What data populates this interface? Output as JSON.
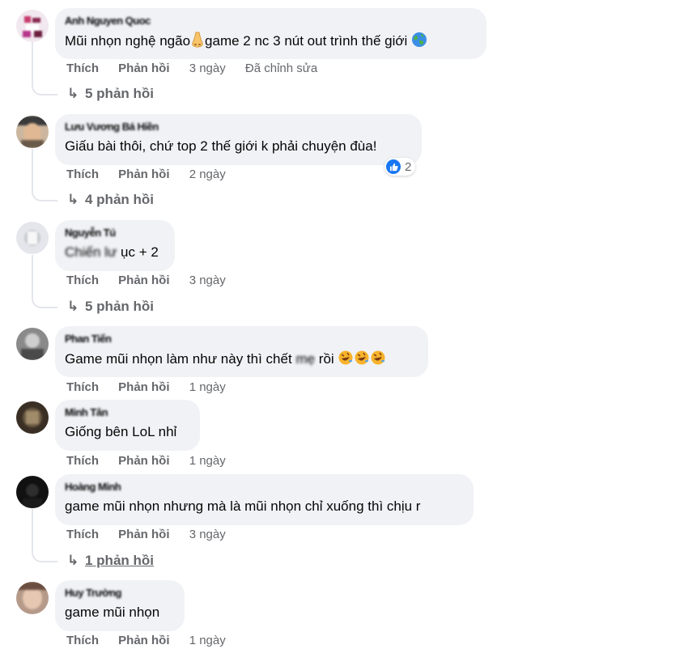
{
  "comments": [
    {
      "author": "Anh Nguyen Quoc",
      "text_before": "Mũi nhọn nghệ ngão",
      "text_after": "game 2 nc 3 nút out trình thế giới",
      "emoji_1": "nose-emoji",
      "emoji_2": "globe-emoji",
      "like": "Thích",
      "reply": "Phản hồi",
      "time": "3 ngày",
      "edited": "Đã chỉnh sửa",
      "replies": "5 phản hồi"
    },
    {
      "author": "Lưu Vương Bá Hiền",
      "text": "Giấu bài thôi, chứ top 2 thế giới k phải chuyện đùa!",
      "like": "Thích",
      "reply": "Phản hồi",
      "time": "2 ngày",
      "reaction_count": "2",
      "reaction_icon": "like-icon",
      "replies": "4 phản hồi"
    },
    {
      "author": "Nguyễn Tú",
      "text_blurred": "Chiến lư",
      "text_after": "ục + 2",
      "like": "Thích",
      "reply": "Phản hồi",
      "time": "3 ngày",
      "replies": "5 phản hồi"
    },
    {
      "author": "Phan Tiến",
      "text_before": "Game mũi nhọn làm như này thì chết",
      "text_blurred": "mẹ",
      "text_after": "rồi",
      "emoji": "rofl-emoji",
      "like": "Thích",
      "reply": "Phản hồi",
      "time": "1 ngày"
    },
    {
      "author": "Minh Tân",
      "text": "Giống bên LoL nhỉ",
      "like": "Thích",
      "reply": "Phản hồi",
      "time": "1 ngày"
    },
    {
      "author": "Hoàng Minh",
      "text": "game mũi nhọn nhưng mà là mũi nhọn chỉ xuống thì chịu r",
      "like": "Thích",
      "reply": "Phản hồi",
      "time": "3 ngày",
      "replies": "1 phản hồi"
    },
    {
      "author": "Huy Trường",
      "text": "game mũi nhọn",
      "like": "Thích",
      "reply": "Phản hồi",
      "time": "1 ngày"
    }
  ],
  "colors": {
    "bubble": "#f0f2f5",
    "meta_text": "#65676b",
    "like_blue": "#1877f2",
    "thread_line": "#e4e6eb"
  }
}
